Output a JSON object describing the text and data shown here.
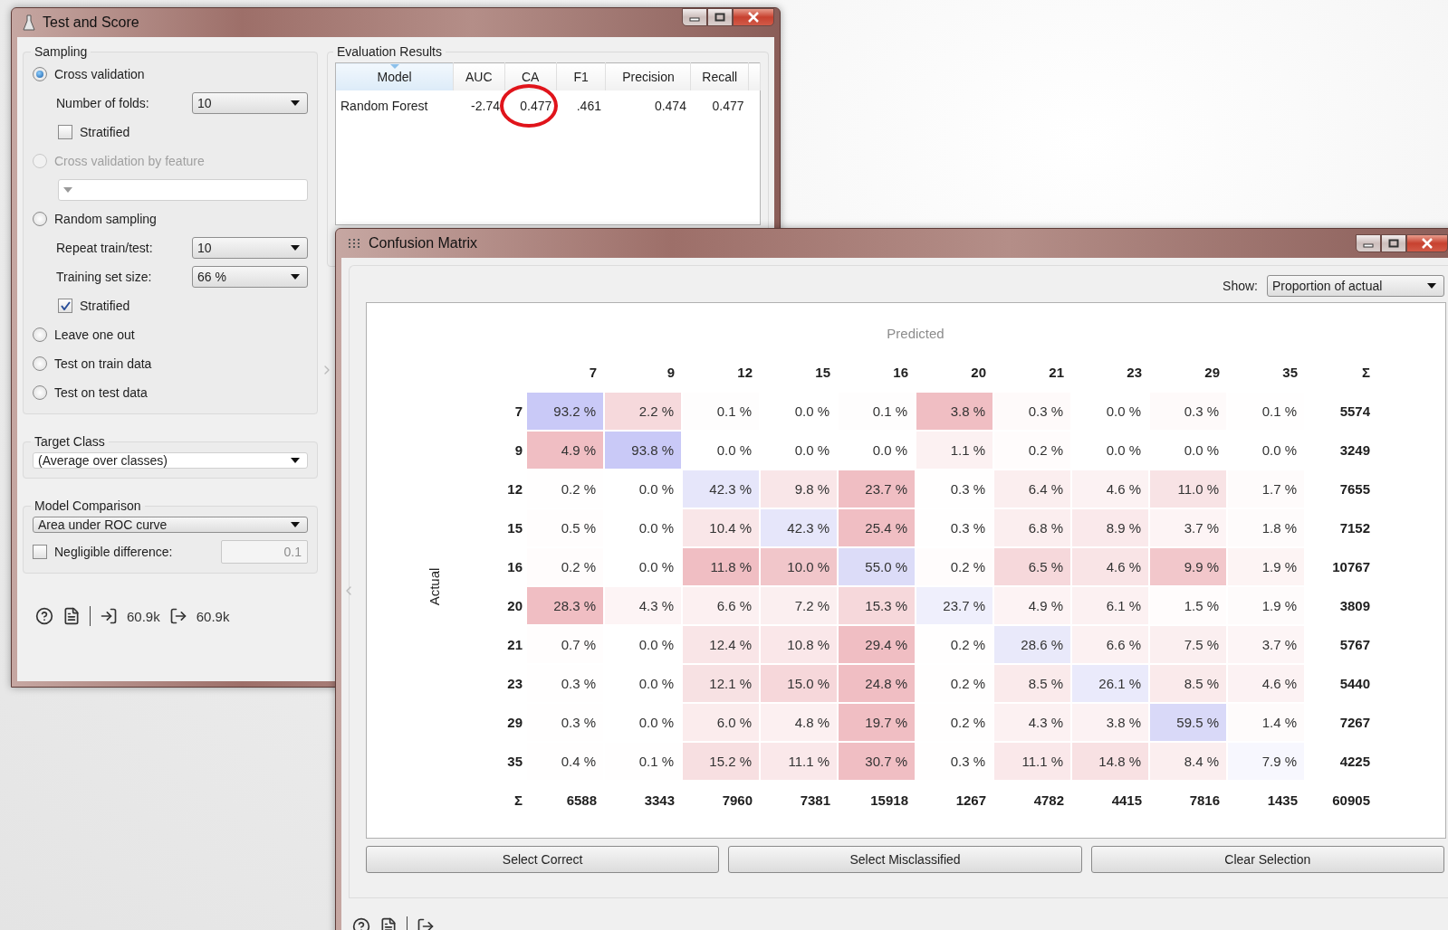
{
  "test_and_score": {
    "title": "Test and Score",
    "sampling": {
      "title": "Sampling",
      "items": [
        {
          "kind": "radio",
          "label": "Cross validation",
          "selected": true,
          "disabled": false
        },
        {
          "kind": "combo",
          "label": "Number of folds:",
          "value": "10"
        },
        {
          "kind": "checkbox",
          "label": "Stratified",
          "checked": false
        },
        {
          "kind": "radio",
          "label": "Cross validation by feature",
          "selected": false,
          "disabled": true
        },
        {
          "kind": "combo"
        },
        {
          "kind": "radio",
          "label": "Random sampling",
          "selected": false,
          "disabled": false
        },
        {
          "kind": "combo",
          "label": "Repeat train/test:",
          "value": "10"
        },
        {
          "kind": "combo",
          "label": "Training set size:",
          "value": "66 %"
        },
        {
          "kind": "checkbox",
          "label": "Stratified",
          "checked": true
        },
        {
          "kind": "radio",
          "label": "Leave one out",
          "selected": false,
          "disabled": false
        },
        {
          "kind": "radio",
          "label": "Test on train data",
          "selected": false,
          "disabled": false
        },
        {
          "kind": "radio",
          "label": "Test on test data",
          "selected": false,
          "disabled": false
        }
      ]
    },
    "target_class": {
      "title": "Target Class",
      "value": "(Average over classes)"
    },
    "model_comparison": {
      "title": "Model Comparison",
      "value": "Area under ROC curve",
      "negligible": {
        "label": "Negligible difference:",
        "checked": false,
        "value": "0.1"
      }
    },
    "evaluation_results": {
      "title": "Evaluation Results",
      "columns": [
        "Model",
        "AUC",
        "CA",
        "F1",
        "Precision",
        "Recall"
      ],
      "rows": [
        [
          {
            "text": "Random Forest",
            "circled": false
          },
          {
            "text": "-2.74",
            "circled": false
          },
          {
            "text": "0.477",
            "circled": true
          },
          {
            "text": ".461",
            "circled": false
          },
          {
            "text": "0.474",
            "circled": false
          },
          {
            "text": "0.477",
            "circled": false
          }
        ]
      ]
    },
    "status_bar": {
      "input": "60.9k",
      "output": "60.9k"
    }
  },
  "confusion_matrix": {
    "title": "Confusion Matrix",
    "show": {
      "label": "Show:",
      "value": "Proportion of actual"
    },
    "predicted_label": "Predicted",
    "actual_label": "Actual",
    "columns": [
      "7",
      "9",
      "12",
      "15",
      "16",
      "20",
      "21",
      "23",
      "29",
      "35",
      "Σ"
    ],
    "rows": [
      {
        "label": "7",
        "total": "5574",
        "cells": [
          {
            "text": "93.2 %",
            "color": "#c9c9f7"
          },
          {
            "text": "2.2 %",
            "color": "#f6d9dc"
          },
          {
            "text": "0.1 %",
            "color": "#fefdfd"
          },
          {
            "text": "0.0 %",
            "color": "#ffffff"
          },
          {
            "text": "0.1 %",
            "color": "#fefdfd"
          },
          {
            "text": "3.8 %",
            "color": "#f0bec3"
          },
          {
            "text": "0.3 %",
            "color": "#fefafa"
          },
          {
            "text": "0.0 %",
            "color": "#ffffff"
          },
          {
            "text": "0.3 %",
            "color": "#fefafa"
          },
          {
            "text": "0.1 %",
            "color": "#fffefe"
          }
        ]
      },
      {
        "label": "9",
        "total": "3249",
        "cells": [
          {
            "text": "4.9 %",
            "color": "#f0bec3"
          },
          {
            "text": "93.8 %",
            "color": "#c9c9f7"
          },
          {
            "text": "0.0 %",
            "color": "#ffffff"
          },
          {
            "text": "0.0 %",
            "color": "#ffffff"
          },
          {
            "text": "0.0 %",
            "color": "#ffffff"
          },
          {
            "text": "1.1 %",
            "color": "#fcf1f2"
          },
          {
            "text": "0.2 %",
            "color": "#fffcfc"
          },
          {
            "text": "0.0 %",
            "color": "#ffffff"
          },
          {
            "text": "0.0 %",
            "color": "#ffffff"
          },
          {
            "text": "0.0 %",
            "color": "#ffffff"
          }
        ]
      },
      {
        "label": "12",
        "total": "7655",
        "cells": [
          {
            "text": "0.2 %",
            "color": "#fffefe"
          },
          {
            "text": "0.0 %",
            "color": "#ffffff"
          },
          {
            "text": "42.3 %",
            "color": "#e6e6fa"
          },
          {
            "text": "9.8 %",
            "color": "#f9e6e8"
          },
          {
            "text": "23.7 %",
            "color": "#f0bec3"
          },
          {
            "text": "0.3 %",
            "color": "#fffefe"
          },
          {
            "text": "6.4 %",
            "color": "#fbeeef"
          },
          {
            "text": "4.6 %",
            "color": "#fcf2f3"
          },
          {
            "text": "11.0 %",
            "color": "#f8e3e5"
          },
          {
            "text": "1.7 %",
            "color": "#fefbfb"
          }
        ]
      },
      {
        "label": "15",
        "total": "7152",
        "cells": [
          {
            "text": "0.5 %",
            "color": "#fffdfd"
          },
          {
            "text": "0.0 %",
            "color": "#ffffff"
          },
          {
            "text": "10.4 %",
            "color": "#f9e6e8"
          },
          {
            "text": "42.3 %",
            "color": "#e6e6fa"
          },
          {
            "text": "25.4 %",
            "color": "#f0bec3"
          },
          {
            "text": "0.3 %",
            "color": "#fffefe"
          },
          {
            "text": "6.8 %",
            "color": "#fbeeef"
          },
          {
            "text": "8.9 %",
            "color": "#fae9eb"
          },
          {
            "text": "3.7 %",
            "color": "#fdf4f5"
          },
          {
            "text": "1.8 %",
            "color": "#fefbfb"
          }
        ]
      },
      {
        "label": "16",
        "total": "10767",
        "cells": [
          {
            "text": "0.2 %",
            "color": "#fffcfc"
          },
          {
            "text": "0.0 %",
            "color": "#ffffff"
          },
          {
            "text": "11.8 %",
            "color": "#f0bec3"
          },
          {
            "text": "10.0 %",
            "color": "#f1c6ca"
          },
          {
            "text": "55.0 %",
            "color": "#dcdcf8"
          },
          {
            "text": "0.2 %",
            "color": "#fffcfc"
          },
          {
            "text": "6.5 %",
            "color": "#f6d8db"
          },
          {
            "text": "4.6 %",
            "color": "#f9e4e6"
          },
          {
            "text": "9.9 %",
            "color": "#f2c7cb"
          },
          {
            "text": "1.9 %",
            "color": "#fdf4f4"
          }
        ]
      },
      {
        "label": "20",
        "total": "3809",
        "cells": [
          {
            "text": "28.3 %",
            "color": "#f0bec3"
          },
          {
            "text": "4.3 %",
            "color": "#fdf4f5"
          },
          {
            "text": "6.6 %",
            "color": "#fcf0f1"
          },
          {
            "text": "7.2 %",
            "color": "#fbeff0"
          },
          {
            "text": "15.3 %",
            "color": "#f6d8db"
          },
          {
            "text": "23.7 %",
            "color": "#efeffc"
          },
          {
            "text": "4.9 %",
            "color": "#fdf3f4"
          },
          {
            "text": "6.1 %",
            "color": "#fcf1f2"
          },
          {
            "text": "1.5 %",
            "color": "#fffcfc"
          },
          {
            "text": "1.9 %",
            "color": "#fefbfb"
          }
        ]
      },
      {
        "label": "21",
        "total": "5767",
        "cells": [
          {
            "text": "0.7 %",
            "color": "#fffdfd"
          },
          {
            "text": "0.0 %",
            "color": "#ffffff"
          },
          {
            "text": "12.4 %",
            "color": "#f9e5e7"
          },
          {
            "text": "10.8 %",
            "color": "#fae7e9"
          },
          {
            "text": "29.4 %",
            "color": "#f0bec3"
          },
          {
            "text": "0.2 %",
            "color": "#fffefe"
          },
          {
            "text": "28.6 %",
            "color": "#e9e9fa"
          },
          {
            "text": "6.6 %",
            "color": "#fcf1f2"
          },
          {
            "text": "7.5 %",
            "color": "#fbeff0"
          },
          {
            "text": "3.7 %",
            "color": "#fdf5f6"
          }
        ]
      },
      {
        "label": "23",
        "total": "5440",
        "cells": [
          {
            "text": "0.3 %",
            "color": "#fffefe"
          },
          {
            "text": "0.0 %",
            "color": "#ffffff"
          },
          {
            "text": "12.1 %",
            "color": "#f7e1e3"
          },
          {
            "text": "15.0 %",
            "color": "#f6d7da"
          },
          {
            "text": "24.8 %",
            "color": "#f0bec3"
          },
          {
            "text": "0.2 %",
            "color": "#fffefe"
          },
          {
            "text": "8.5 %",
            "color": "#faeaeb"
          },
          {
            "text": "26.1 %",
            "color": "#eaeafb"
          },
          {
            "text": "8.5 %",
            "color": "#faeaeb"
          },
          {
            "text": "4.6 %",
            "color": "#fcf2f3"
          }
        ]
      },
      {
        "label": "29",
        "total": "7267",
        "cells": [
          {
            "text": "0.3 %",
            "color": "#fffefe"
          },
          {
            "text": "0.0 %",
            "color": "#ffffff"
          },
          {
            "text": "6.0 %",
            "color": "#fbeced"
          },
          {
            "text": "4.8 %",
            "color": "#fcf0f1"
          },
          {
            "text": "19.7 %",
            "color": "#f0bec3"
          },
          {
            "text": "0.2 %",
            "color": "#fffefe"
          },
          {
            "text": "4.3 %",
            "color": "#fcf1f2"
          },
          {
            "text": "3.8 %",
            "color": "#fcf2f3"
          },
          {
            "text": "59.5 %",
            "color": "#d9d9f8"
          },
          {
            "text": "1.4 %",
            "color": "#fefbfb"
          }
        ]
      },
      {
        "label": "35",
        "total": "4225",
        "cells": [
          {
            "text": "0.4 %",
            "color": "#fffefe"
          },
          {
            "text": "0.1 %",
            "color": "#fffefe"
          },
          {
            "text": "15.2 %",
            "color": "#f7dfe1"
          },
          {
            "text": "11.1 %",
            "color": "#fae8ea"
          },
          {
            "text": "30.7 %",
            "color": "#f0bec3"
          },
          {
            "text": "0.3 %",
            "color": "#fffefe"
          },
          {
            "text": "11.1 %",
            "color": "#fae8ea"
          },
          {
            "text": "14.8 %",
            "color": "#f8e1e3"
          },
          {
            "text": "8.4 %",
            "color": "#fbeeef"
          },
          {
            "text": "7.9 %",
            "color": "#f7f7fe"
          }
        ]
      }
    ],
    "totals": {
      "label": "Σ",
      "values": [
        "6588",
        "3343",
        "7960",
        "7381",
        "15918",
        "1267",
        "4782",
        "4415",
        "7816",
        "1435"
      ],
      "grand": "60905"
    },
    "buttons": [
      "Select Correct",
      "Select Misclassified",
      "Clear Selection"
    ]
  }
}
